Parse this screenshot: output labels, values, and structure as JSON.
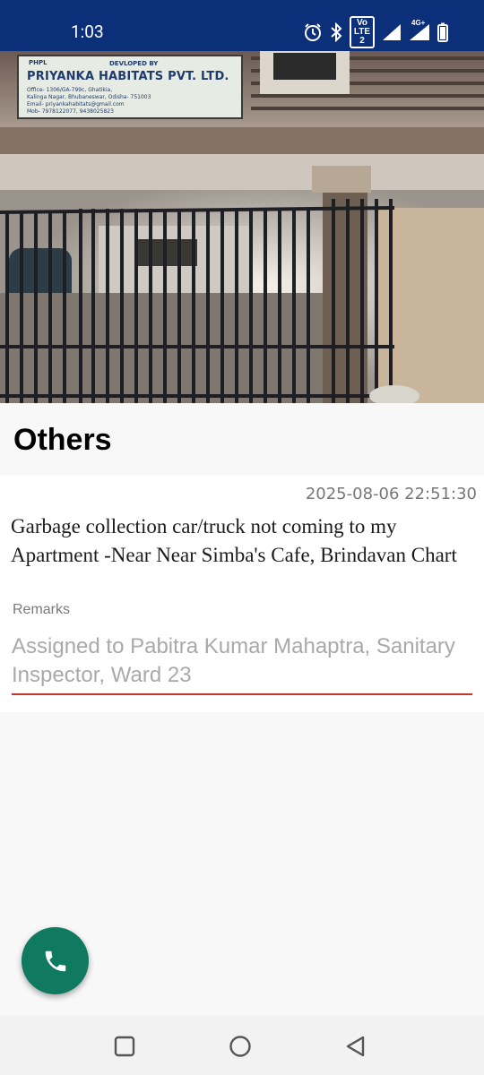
{
  "status_bar": {
    "time": "1:03",
    "icons": [
      "alarm-icon",
      "bluetooth-icon",
      "volte-icon",
      "signal-icon",
      "4g-signal-icon",
      "battery-icon"
    ],
    "volte_text_top": "Vo",
    "volte_text_bottom": "LTE 2",
    "network_label": "4G+"
  },
  "hero": {
    "sign": {
      "line1": "DEVLOPED BY",
      "line2": "PRIYANKA HABITATS PVT. LTD.",
      "line3": "Office- 1306/GA-799c, Ghatikia,",
      "line4": "Kalinga Nagar, Bhubaneswar, Odisha- 751003",
      "line5": "Email- priyankahabitats@gmail.com",
      "line6": "Mob- 7978122077, 9438025823",
      "logo_text": "PHPL"
    }
  },
  "section": {
    "title": "Others"
  },
  "complaint": {
    "timestamp": "2025-08-06 22:51:30",
    "description": "Garbage collection car/truck not coming to my Apartment -Near Near Simba's Cafe, Brindavan Chart",
    "remarks_label": "Remarks",
    "remarks_value": "Assigned to Pabitra Kumar Mahaptra, Sanitary Inspector, Ward 23"
  },
  "fab": {
    "icon": "phone-icon"
  },
  "nav": {
    "icons": [
      "recents-icon",
      "home-icon",
      "back-icon"
    ]
  },
  "colors": {
    "status_bar": "#0c2f7a",
    "fab": "#0f7a5f",
    "underline": "#c0392b"
  }
}
